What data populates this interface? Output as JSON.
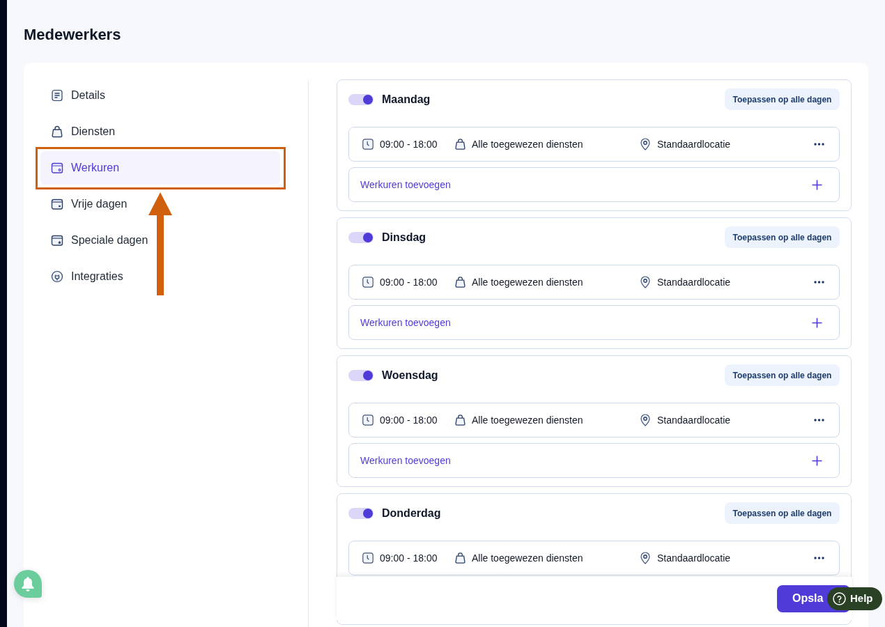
{
  "page": {
    "title": "Medewerkers"
  },
  "sidebar": {
    "items": [
      {
        "label": "Details",
        "selected": false
      },
      {
        "label": "Diensten",
        "selected": false
      },
      {
        "label": "Werkuren",
        "selected": true
      },
      {
        "label": "Vrije dagen",
        "selected": false
      },
      {
        "label": "Speciale dagen",
        "selected": false
      },
      {
        "label": "Integraties",
        "selected": false
      }
    ]
  },
  "days": [
    {
      "name": "Maandag",
      "on": true,
      "apply_button": "Toepassen op alle dagen",
      "shifts": [
        {
          "time": "09:00 - 18:00",
          "services": "Alle toegewezen diensten",
          "location": "Standaardlocatie"
        }
      ],
      "add_label": "Werkuren toevoegen"
    },
    {
      "name": "Dinsdag",
      "on": true,
      "apply_button": "Toepassen op alle dagen",
      "shifts": [
        {
          "time": "09:00 - 18:00",
          "services": "Alle toegewezen diensten",
          "location": "Standaardlocatie"
        }
      ],
      "add_label": "Werkuren toevoegen"
    },
    {
      "name": "Woensdag",
      "on": true,
      "apply_button": "Toepassen op alle dagen",
      "shifts": [
        {
          "time": "09:00 - 18:00",
          "services": "Alle toegewezen diensten",
          "location": "Standaardlocatie"
        }
      ],
      "add_label": "Werkuren toevoegen"
    },
    {
      "name": "Donderdag",
      "on": true,
      "apply_button": "Toepassen op alle dagen",
      "shifts": [
        {
          "time": "09:00 - 18:00",
          "services": "Alle toegewezen diensten",
          "location": "Standaardlocatie"
        }
      ]
    }
  ],
  "footer": {
    "save_button": "Opsla"
  },
  "help_button": {
    "label": "Help"
  }
}
